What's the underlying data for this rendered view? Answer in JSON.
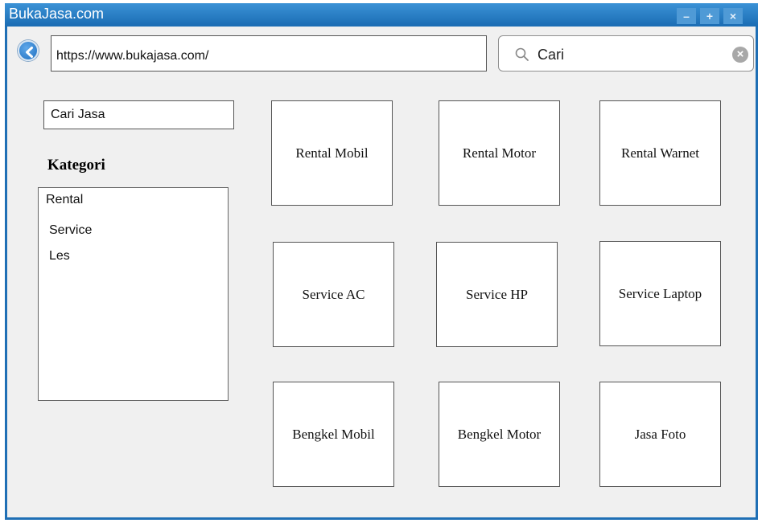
{
  "window": {
    "title": "BukaJasa.com",
    "controls": {
      "minimize": "–",
      "maximize": "+",
      "close": "×"
    }
  },
  "address_bar": {
    "url": "https://www.bukajasa.com/"
  },
  "search": {
    "value": "Cari",
    "icon": "search-icon",
    "clear_icon": "clear-icon",
    "clear_glyph": "×"
  },
  "sidebar": {
    "search_field_value": "Cari Jasa",
    "heading": "Kategori",
    "categories": [
      {
        "label": "Rental"
      },
      {
        "label": "Service"
      },
      {
        "label": "Les"
      }
    ]
  },
  "services": [
    {
      "label": "Rental Mobil"
    },
    {
      "label": "Rental Motor"
    },
    {
      "label": "Rental Warnet"
    },
    {
      "label": "Service AC"
    },
    {
      "label": "Service HP"
    },
    {
      "label": "Service Laptop"
    },
    {
      "label": "Bengkel Mobil"
    },
    {
      "label": "Bengkel Motor"
    },
    {
      "label": "Jasa Foto"
    }
  ],
  "colors": {
    "titlebar": "#1a6cb3",
    "accent": "#1f6fc0",
    "background": "#f0f0f0"
  }
}
